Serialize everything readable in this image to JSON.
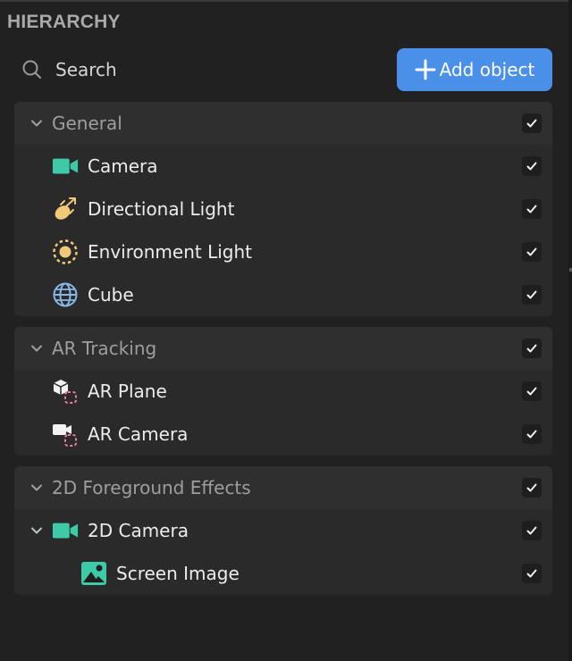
{
  "panel": {
    "title": "HIERARCHY"
  },
  "search": {
    "placeholder": "Search"
  },
  "add_button": {
    "label": "Add object"
  },
  "groups": [
    {
      "name": "General",
      "checked": true,
      "items": [
        {
          "label": "Camera",
          "icon": "camera-icon",
          "checked": true
        },
        {
          "label": "Directional Light",
          "icon": "directional-light-icon",
          "checked": true
        },
        {
          "label": "Environment Light",
          "icon": "environment-light-icon",
          "checked": true
        },
        {
          "label": "Cube",
          "icon": "cube-mesh-icon",
          "checked": true
        }
      ]
    },
    {
      "name": "AR Tracking",
      "checked": true,
      "items": [
        {
          "label": "AR Plane",
          "icon": "ar-plane-icon",
          "checked": true
        },
        {
          "label": "AR Camera",
          "icon": "ar-camera-icon",
          "checked": true
        }
      ]
    },
    {
      "name": "2D Foreground Effects",
      "checked": true,
      "items": [
        {
          "label": "2D Camera",
          "icon": "camera-icon",
          "checked": true,
          "expanded": true
        },
        {
          "label": "Screen Image",
          "icon": "image-icon",
          "checked": true,
          "indent": true
        }
      ]
    }
  ],
  "colors": {
    "background": "#212121",
    "group_background": "#2a2a2a",
    "accent_button": "#4a90e8",
    "camera_icon": "#3ec9a7",
    "light_icon": "#f2c979",
    "globe_icon": "#8ab8e6",
    "ar_marker": "#f07aa0"
  }
}
